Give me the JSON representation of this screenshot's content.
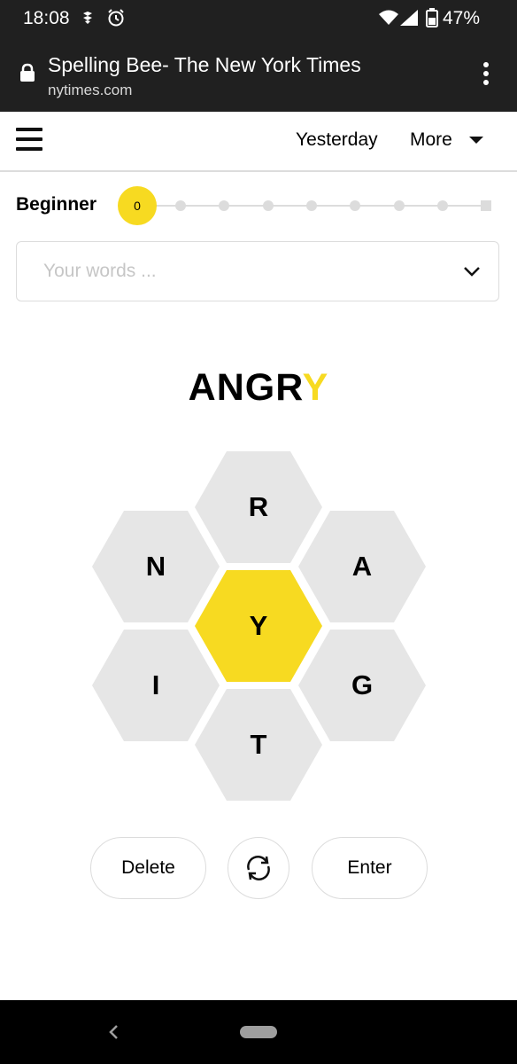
{
  "status_bar": {
    "time": "18:08",
    "battery": "47%",
    "icons": [
      "notification-icon",
      "alarm-icon",
      "wifi-icon",
      "signal-icon",
      "battery-icon"
    ]
  },
  "browser": {
    "title": "Spelling Bee- The New York Times",
    "url": "nytimes.com"
  },
  "header": {
    "yesterday_label": "Yesterday",
    "more_label": "More"
  },
  "progress": {
    "rank": "Beginner",
    "score": "0",
    "level_index": 0,
    "levels": 9
  },
  "word_list": {
    "placeholder": "Your words ..."
  },
  "current_word": {
    "prefix": "ANGR",
    "center": "Y"
  },
  "hive": {
    "top": "R",
    "upper_left": "N",
    "upper_right": "A",
    "center": "Y",
    "lower_left": "I",
    "lower_right": "G",
    "bottom": "T"
  },
  "buttons": {
    "delete": "Delete",
    "enter": "Enter"
  },
  "colors": {
    "accent_yellow": "#f7da21",
    "cell_gray": "#e6e6e6",
    "chrome_dark": "#202020"
  }
}
